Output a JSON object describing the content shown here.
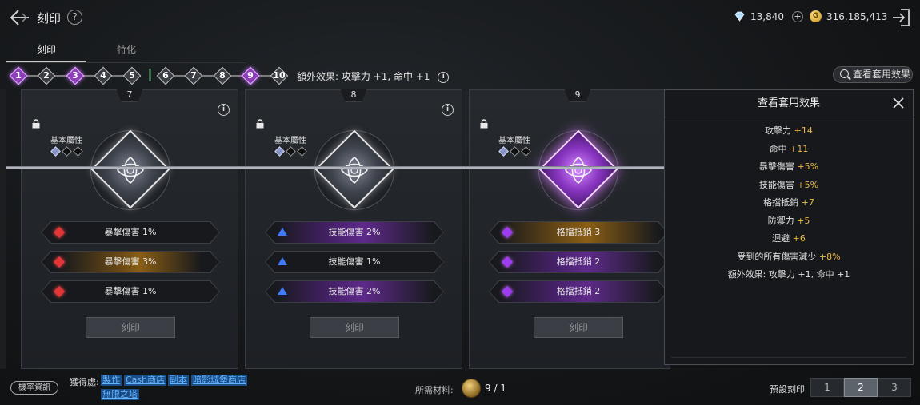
{
  "header": {
    "title": "刻印",
    "help": "?",
    "diamond_count": "13,840",
    "gold_count": "316,185,413",
    "gold_symbol": "G"
  },
  "tabs": [
    {
      "label": "刻印",
      "active": true
    },
    {
      "label": "特化",
      "active": false
    }
  ],
  "steps": [
    {
      "n": "1",
      "purple": true
    },
    {
      "n": "2",
      "purple": false
    },
    {
      "n": "3",
      "purple": true
    },
    {
      "n": "4",
      "purple": false
    },
    {
      "n": "5",
      "purple": false
    },
    {
      "n": "6",
      "purple": false
    },
    {
      "n": "7",
      "purple": false
    },
    {
      "n": "8",
      "purple": false
    },
    {
      "n": "9",
      "purple": true
    },
    {
      "n": "10",
      "purple": false
    }
  ],
  "bonus_text": "額外效果: 攻擊力 +1, 命中 +1",
  "view_effects_button": "查看套用效果",
  "cards": [
    {
      "number": "7",
      "base_label": "基本屬性",
      "info": "i",
      "gem": "silver",
      "stats": [
        {
          "icon": "red",
          "text": "暴擊傷害 1%",
          "glow": ""
        },
        {
          "icon": "red",
          "text": "暴擊傷害 3%",
          "glow": "orange"
        },
        {
          "icon": "red",
          "text": "暴擊傷害 1%",
          "glow": ""
        }
      ],
      "button": "刻印"
    },
    {
      "number": "8",
      "base_label": "基本屬性",
      "info": "i",
      "gem": "silver",
      "stats": [
        {
          "icon": "blue",
          "text": "技能傷害 2%",
          "glow": "purple"
        },
        {
          "icon": "blue",
          "text": "技能傷害 1%",
          "glow": ""
        },
        {
          "icon": "blue",
          "text": "技能傷害 2%",
          "glow": "purple"
        }
      ],
      "button": "刻印"
    },
    {
      "number": "9",
      "base_label": "基本屬性",
      "info": "i",
      "gem": "purple",
      "stats": [
        {
          "icon": "purple",
          "text": "格擋抵銷 3",
          "glow": "orange2"
        },
        {
          "icon": "purple",
          "text": "格擋抵銷 2",
          "glow": "purple"
        },
        {
          "icon": "purple",
          "text": "格擋抵銷 2",
          "glow": "purple"
        }
      ],
      "button": "刻印"
    }
  ],
  "popup": {
    "title": "查看套用效果",
    "effects": [
      {
        "label": "攻擊力",
        "value": "+14"
      },
      {
        "label": "命中",
        "value": "+11"
      },
      {
        "label": "暴擊傷害",
        "value": "+5%"
      },
      {
        "label": "技能傷害",
        "value": "+5%"
      },
      {
        "label": "格擋抵銷",
        "value": "+7"
      },
      {
        "label": "防禦力",
        "value": "+5"
      },
      {
        "label": "迴避",
        "value": "+6"
      },
      {
        "label": "受到的所有傷害減少",
        "value": "+8%"
      },
      {
        "label": "額外效果: 攻擊力 +1, 命中 +1",
        "value": ""
      }
    ]
  },
  "footer": {
    "prob_button": "機率資訊",
    "source_label": "獲得處:",
    "sources": [
      "製作",
      "Cash商店",
      "副本",
      "暗影城堡商店",
      "無限之塔"
    ],
    "material_label": "所需材料:",
    "material_count": "9 / 1",
    "preset_label": "預設刻印",
    "presets": [
      "1",
      "2",
      "3"
    ],
    "preset_active": "2"
  },
  "colors": {
    "accent_purple": "#8d3fb8",
    "value_gold": "#e9b846",
    "link_blue": "#63b3ff"
  }
}
